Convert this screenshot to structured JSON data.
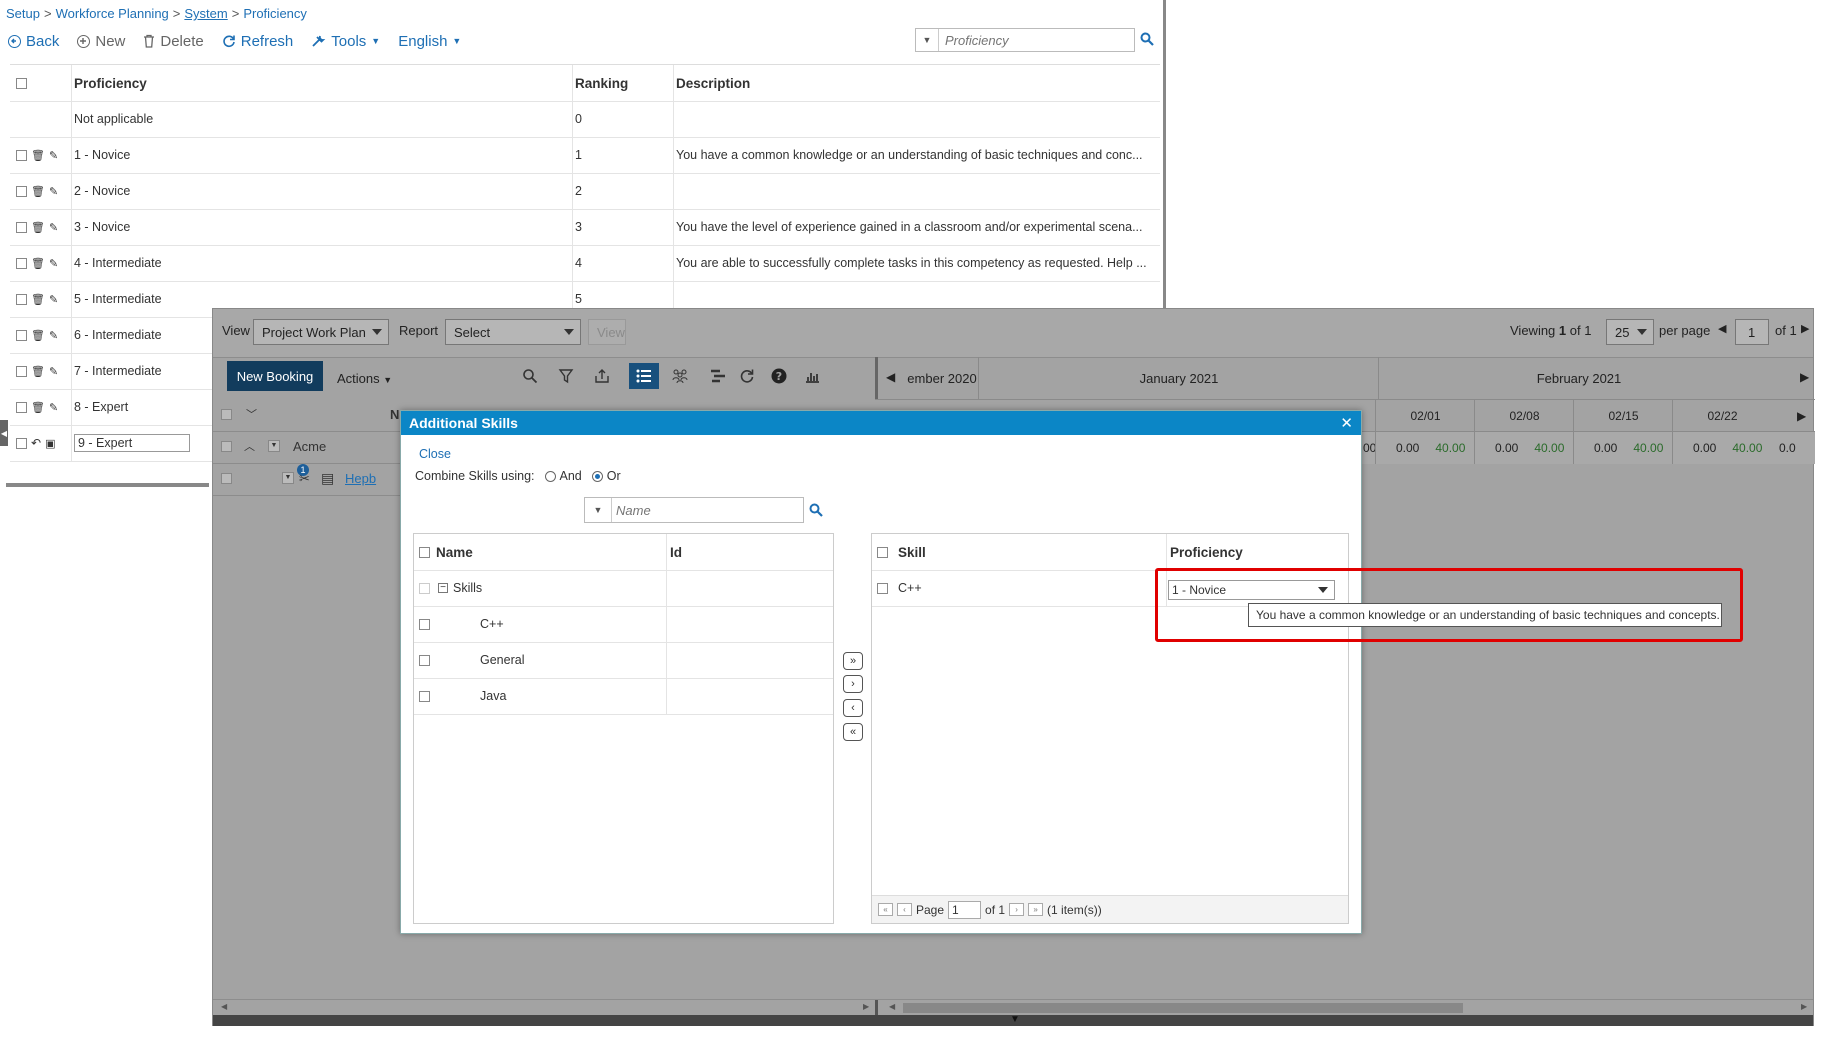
{
  "breadcrumb": {
    "setup": "Setup",
    "workforce": "Workforce Planning",
    "system": "System",
    "proficiency": "Proficiency",
    "sep": ">"
  },
  "toolbar": {
    "back": "Back",
    "new": "New",
    "delete": "Delete",
    "refresh": "Refresh",
    "tools": "Tools",
    "language": "English"
  },
  "search": {
    "placeholder": "Proficiency"
  },
  "grid": {
    "headers": {
      "proficiency": "Proficiency",
      "ranking": "Ranking",
      "description": "Description"
    },
    "rows": [
      {
        "name": "Not applicable",
        "ranking": "0",
        "description": ""
      },
      {
        "name": "1 - Novice",
        "ranking": "1",
        "description": "You have a common knowledge or an understanding of basic techniques and conc..."
      },
      {
        "name": "2 - Novice",
        "ranking": "2",
        "description": ""
      },
      {
        "name": "3 - Novice",
        "ranking": "3",
        "description": "You have the level of experience gained in a classroom and/or experimental scena..."
      },
      {
        "name": "4 - Intermediate",
        "ranking": "4",
        "description": "You are able to successfully complete tasks in this competency as requested. Help ..."
      },
      {
        "name": "5 - Intermediate",
        "ranking": "5",
        "description": ""
      },
      {
        "name": "6 - Intermediate",
        "ranking": "",
        "description": ""
      },
      {
        "name": "7 - Intermediate",
        "ranking": "",
        "description": ""
      },
      {
        "name": "8 - Expert",
        "ranking": "",
        "description": ""
      },
      {
        "name": "9 - Expert",
        "ranking": "",
        "description": ""
      }
    ]
  },
  "scheduler": {
    "view_label": "View",
    "view_value": "Project Work Plan",
    "report_label": "Report",
    "report_value": "Select",
    "view_button": "View",
    "viewing": "Viewing",
    "viewing_count": "1",
    "of_label": "of",
    "viewing_total": "1",
    "per_page_value": "25",
    "per_page_label": "per page",
    "page_value": "1",
    "page_of": "of 1",
    "new_booking": "New Booking",
    "actions": "Actions",
    "months": [
      "ember 2020",
      "January 2021",
      "February 2021"
    ],
    "weeks": [
      "02/01",
      "02/08",
      "02/15",
      "02/22"
    ],
    "week_values": [
      {
        "a": "0.00",
        "b": "40.00"
      },
      {
        "a": "0.00",
        "b": "40.00"
      },
      {
        "a": "0.00",
        "b": "40.00"
      },
      {
        "a": "0.00",
        "b": "40.00"
      }
    ],
    "partial_left": "00",
    "partial_right": "0.0",
    "col_n": "N",
    "row_acme": "Acme",
    "row_hepb": "Hepb",
    "badge": "1"
  },
  "modal": {
    "title": "Additional Skills",
    "close": "Close",
    "combine_label": "Combine Skills using:",
    "and": "And",
    "or": "Or",
    "name_placeholder": "Name",
    "left_headers": {
      "name": "Name",
      "id": "Id"
    },
    "left_rows": [
      "Skills",
      "C++",
      "General",
      "Java"
    ],
    "right_headers": {
      "skill": "Skill",
      "proficiency": "Proficiency"
    },
    "right_rows": [
      {
        "skill": "C++",
        "proficiency": "1 - Novice"
      }
    ],
    "pager": {
      "page": "Page",
      "page_value": "1",
      "of": "of 1",
      "items": "(1 item(s))"
    }
  },
  "tooltip": "You have a common knowledge or an understanding of basic techniques and concepts.",
  "colors": {
    "accent": "#1e6fb4",
    "modal_header": "#0b86c6",
    "highlight": "#e00000",
    "new_booking": "#123c5d"
  }
}
